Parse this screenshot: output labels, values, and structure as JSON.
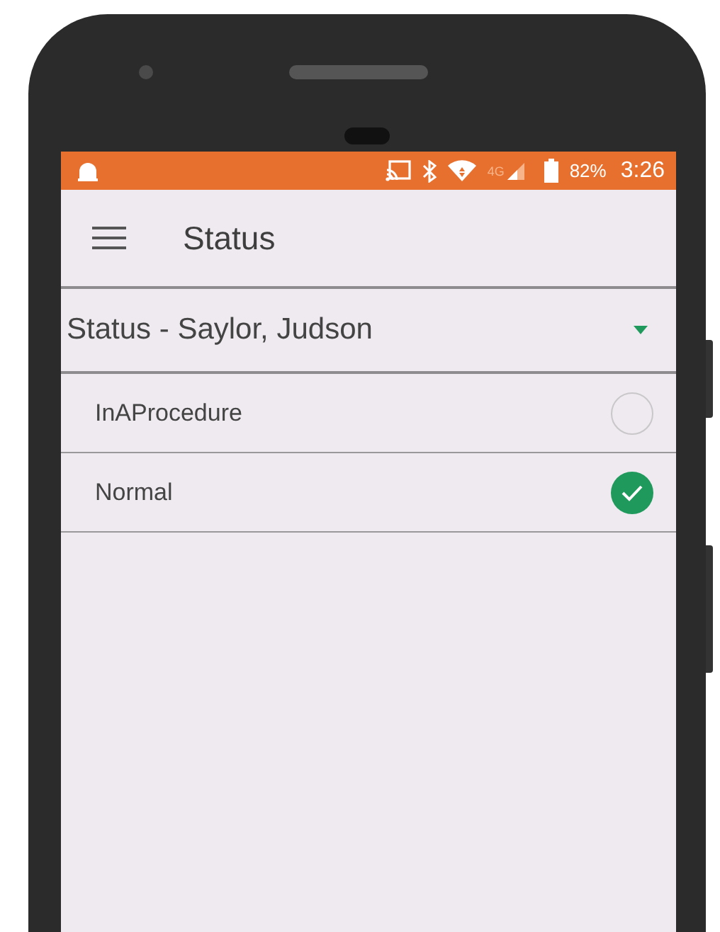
{
  "status_bar": {
    "network": "4G",
    "battery": "82%",
    "time": "3:26"
  },
  "app_bar": {
    "title": "Status"
  },
  "dropdown": {
    "value": "Status - Saylor, Judson"
  },
  "options": [
    {
      "label": "InAProcedure",
      "selected": false
    },
    {
      "label": "Normal",
      "selected": true
    }
  ]
}
